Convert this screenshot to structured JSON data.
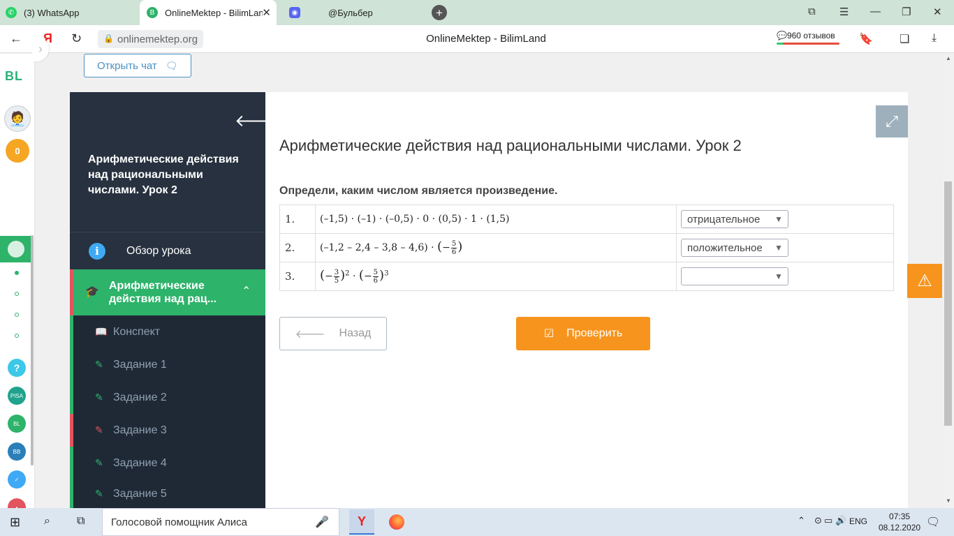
{
  "browser": {
    "tabs": [
      {
        "label": "(3) WhatsApp"
      },
      {
        "label": "OnlineMektep - BilimLand"
      },
      {
        "label": "@Бульбер"
      }
    ],
    "url": "onlinemektep.org",
    "page_title": "OnlineMektep - BilimLand",
    "reviews": "960 отзывов"
  },
  "rail": {
    "logo": "BL",
    "coins": "0"
  },
  "page": {
    "chat_button": "Открыть чат",
    "lesson_title": "Арифметические действия над рациональными числами. Урок 2",
    "overview_label": "Обзор урока",
    "section_label": "Арифметические действия над рац...",
    "items": [
      {
        "label": "Конспект"
      },
      {
        "label": "Задание 1"
      },
      {
        "label": "Задание 2"
      },
      {
        "label": "Задание 3"
      },
      {
        "label": "Задание 4"
      },
      {
        "label": "Задание 5"
      }
    ],
    "heading": "Арифметические действия над рациональными числами. Урок 2",
    "instruction": "Определи, каким числом является произведение.",
    "rows": [
      {
        "num": "1.",
        "expr": "(–1,5) · (–1) · (–0,5) · 0 · (0,5) · 1 · (1,5)",
        "answer": "отрицательное"
      },
      {
        "num": "2.",
        "expr": "(–1,2 – 2,4 – 3,8 – 4,6) · (−5/6)",
        "answer": "положительное"
      },
      {
        "num": "3.",
        "expr": "(−3/5)² · (−5/6)³",
        "answer": ""
      }
    ],
    "back_button": "Назад",
    "check_button": "Проверить"
  },
  "taskbar": {
    "search": "Голосовой помощник Алиса",
    "lang": "ENG",
    "time": "07:35",
    "date": "08.12.2020"
  },
  "colors": {
    "accent_green": "#2db36a",
    "panel_dark": "#27313f",
    "orange": "#f7941d",
    "red_marker": "#e2545e"
  }
}
